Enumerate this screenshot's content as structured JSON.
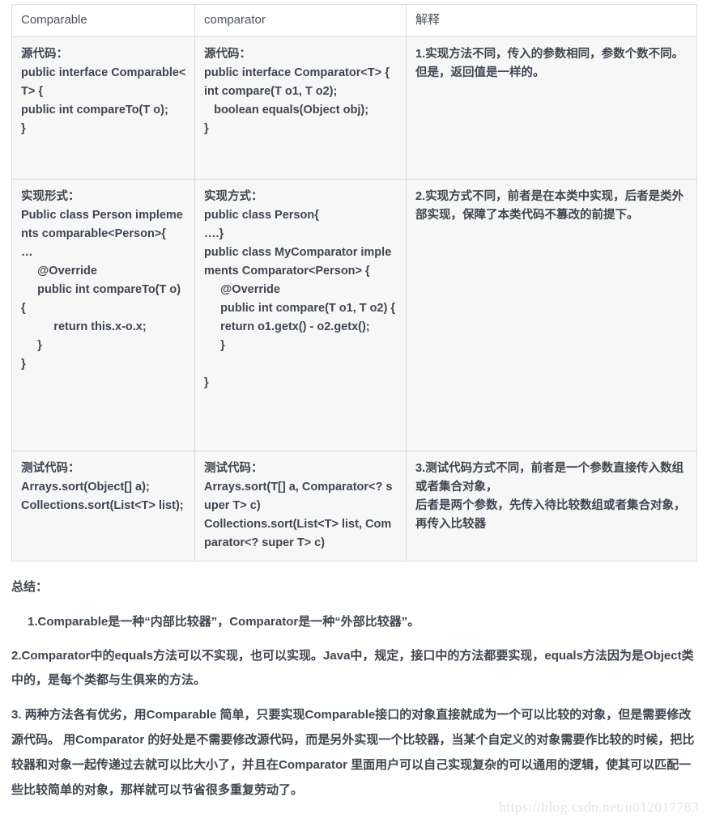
{
  "table": {
    "headers": [
      "Comparable",
      "comparator",
      "解释"
    ],
    "rows": [
      {
        "name": "source-code",
        "comparable": "源代码：\npublic interface Comparable<T> {\npublic int compareTo(T o);\n}",
        "comparator": "源代码：\npublic interface Comparator<T> {\nint compare(T o1, T o2);\n   boolean equals(Object obj);\n}",
        "explanation": "1.实现方法不同，传入的参数相同，参数个数不同。但是，返回值是一样的。"
      },
      {
        "name": "implementation",
        "comparable": "实现形式：\nPublic class Person implements comparable<Person>{\n…\n     @Override\n     public int compareTo(T o) {\n          return this.x-o.x;\n     }\n}",
        "comparator": "实现方式：\npublic class Person{\n….}\npublic class MyComparator implements Comparator<Person> {\n     @Override\n     public int compare(T o1, T o2) {\n     return o1.getx() - o2.getx();\n     }\n\n}",
        "explanation": "2.实现方式不同，前者是在本类中实现，后者是类外部实现，保障了本类代码不篡改的前提下。"
      },
      {
        "name": "test-code",
        "comparable": "测试代码：\nArrays.sort(Object[] a);\nCollections.sort(List<T> list);",
        "comparator": "测试代码：\nArrays.sort(T[] a, Comparator<? super T> c)\nCollections.sort(List<T> list, Comparator<? super T> c)",
        "explanation": "3.测试代码方式不同，前者是一个参数直接传入数组或者集合对象，\n后者是两个参数，先传入待比较数组或者集合对象，再传入比较器"
      }
    ]
  },
  "summary": {
    "title": "总结：",
    "items": [
      "1.Comparable是一种“内部比较器”，Comparator是一种“外部比较器”。",
      "2.Comparator中的equals方法可以不实现，也可以实现。Java中，规定，接口中的方法都要实现，equals方法因为是Object类中的，是每个类都与生俱来的方法。",
      "3. 两种方法各有优劣，用Comparable 简单，只要实现Comparable接口的对象直接就成为一个可以比较的对象，但是需要修改源代码。 用Comparator 的好处是不需要修改源代码，而是另外实现一个比较器，当某个自定义的对象需要作比较的时候，把比较器和对象一起传递过去就可以比大小了，并且在Comparator 里面用户可以自己实现复杂的可以通用的逻辑，使其可以匹配一些比较简单的对象，那样就可以节省很多重复劳动了。"
    ]
  },
  "watermark": "https://blog.csdn.net/u012017783"
}
